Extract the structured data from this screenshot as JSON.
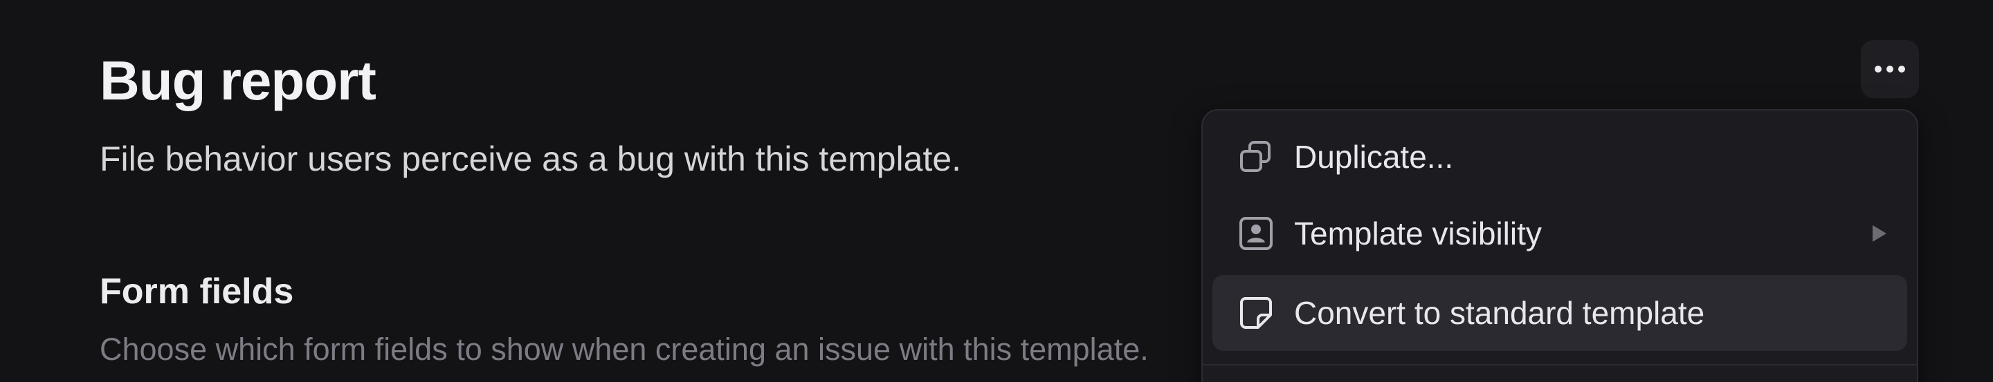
{
  "header": {
    "title": "Bug report",
    "description": "File behavior users perceive as a bug with this template."
  },
  "form_fields": {
    "title": "Form fields",
    "description": "Choose which form fields to show when creating an issue with this template."
  },
  "more_button": {
    "icon": "ellipsis-icon"
  },
  "menu": {
    "items": [
      {
        "label": "Duplicate...",
        "icon": "duplicate-icon",
        "submenu": false,
        "active": false
      },
      {
        "label": "Template visibility",
        "icon": "visibility-icon",
        "submenu": true,
        "active": false
      },
      {
        "label": "Convert to standard template",
        "icon": "convert-icon",
        "submenu": false,
        "active": true
      }
    ]
  },
  "colors": {
    "background": "#131215",
    "menu_background": "#1c1b20",
    "menu_item_active": "#2b2a31",
    "primary_text": "#f2f2f4",
    "muted_text": "#7c7c84"
  }
}
